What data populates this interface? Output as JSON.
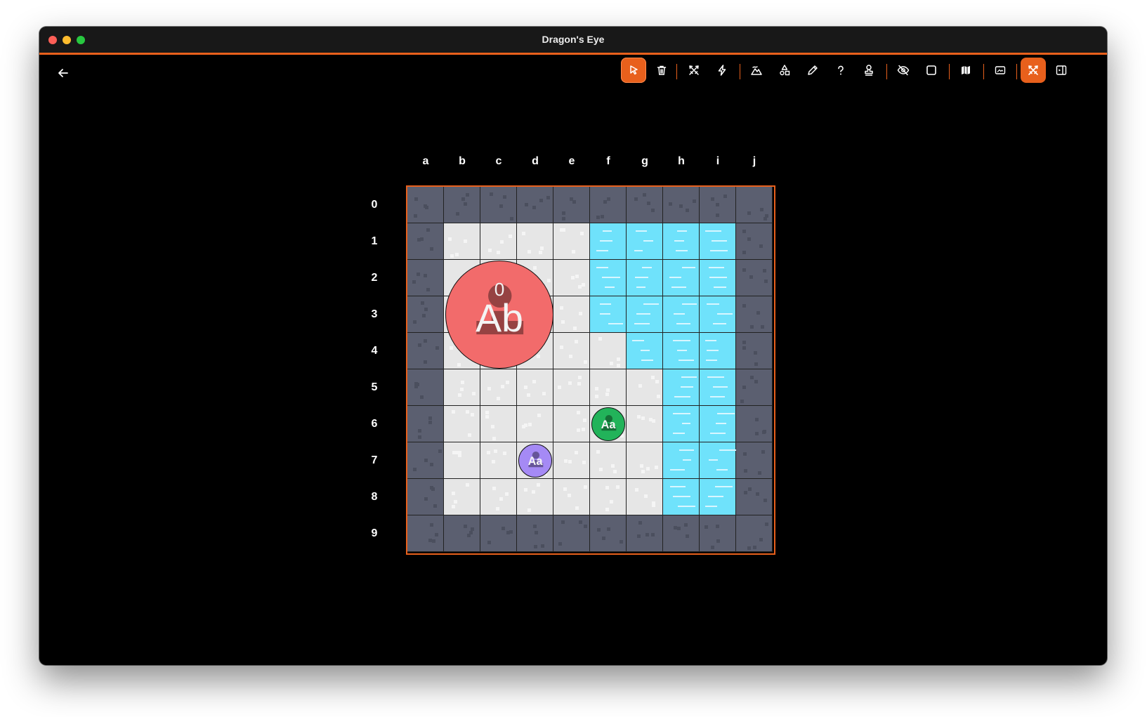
{
  "window": {
    "title": "Dragon's Eye"
  },
  "toolbar": {
    "tools": [
      {
        "name": "select-tool",
        "icon": "cursor-arrow-icon",
        "active": true
      },
      {
        "name": "delete-tool",
        "icon": "trash-icon"
      },
      {
        "name": "attack-tool",
        "icon": "crossed-swords-icon"
      },
      {
        "name": "effect-tool",
        "icon": "lightning-icon"
      },
      {
        "name": "terrain-tool",
        "icon": "mountain-icon"
      },
      {
        "name": "shapes-tool",
        "icon": "shapes-icon"
      },
      {
        "name": "draw-tool",
        "icon": "pencil-icon"
      },
      {
        "name": "help-tool",
        "icon": "question-mark-icon"
      },
      {
        "name": "stamp-tool",
        "icon": "stamp-icon"
      },
      {
        "name": "visibility-tool",
        "icon": "eye-slash-icon"
      },
      {
        "name": "frame-tool",
        "icon": "square-icon"
      },
      {
        "name": "map-tool",
        "icon": "map-icon"
      },
      {
        "name": "screen-tool",
        "icon": "picture-frame-icon"
      },
      {
        "name": "combat-mode-toggle",
        "icon": "crossed-swords-icon",
        "active": true
      },
      {
        "name": "sidebar-toggle",
        "icon": "sidebar-icon"
      }
    ]
  },
  "grid": {
    "columns": [
      "a",
      "b",
      "c",
      "d",
      "e",
      "f",
      "g",
      "h",
      "i",
      "j"
    ],
    "rows": [
      "0",
      "1",
      "2",
      "3",
      "4",
      "5",
      "6",
      "7",
      "8",
      "9"
    ],
    "tiles": [
      "WWWWWWWWWW",
      "WFFFFBBBBW",
      "WFFFFBBBBW",
      "WFFFFBBBBW",
      "WFFFFFBBBW",
      "WFFFFFFBBW",
      "WFFFFFFBBW",
      "WFFFFFFBBW",
      "WFFFFFFBBW",
      "WWWWWWWWWW"
    ]
  },
  "tokens": [
    {
      "label": "Ab",
      "badge": "0",
      "color": "#f26b6b",
      "col": 2,
      "row": 3,
      "size": 3
    },
    {
      "label": "Aa",
      "badge": "",
      "color": "#22b35a",
      "col": 5,
      "row": 6,
      "size": 1
    },
    {
      "label": "Aa",
      "badge": "",
      "color": "#a58af5",
      "col": 3,
      "row": 7,
      "size": 1
    }
  ],
  "colors": {
    "accent": "#e8601c",
    "wall": "#5b5f70",
    "floor": "#e6e6e6",
    "water": "#6fe2fb"
  }
}
